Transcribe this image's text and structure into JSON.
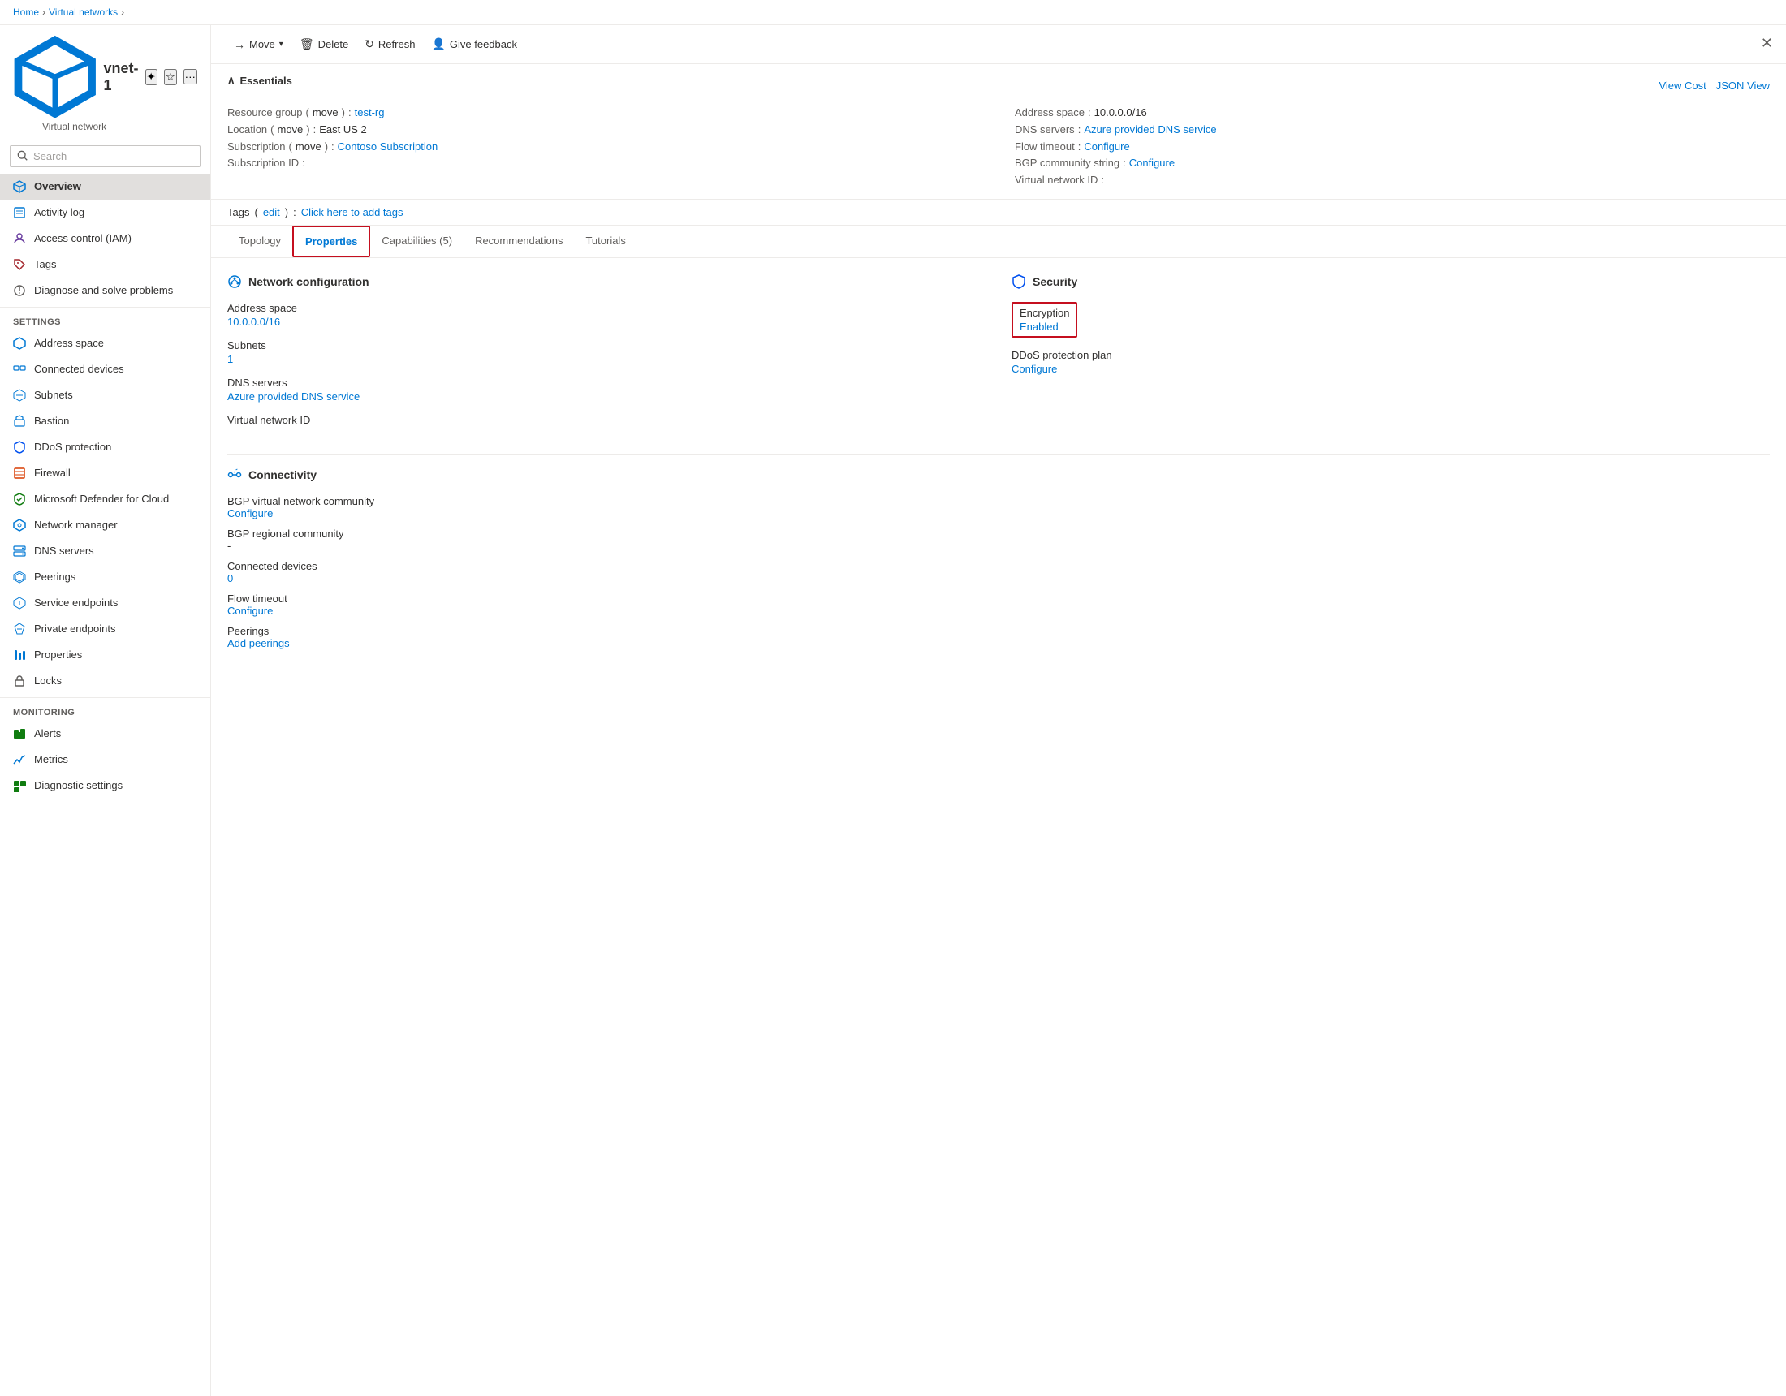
{
  "breadcrumb": {
    "home": "Home",
    "section": "Virtual networks",
    "current": ""
  },
  "header": {
    "title": "vnet-1",
    "subtitle": "Virtual network",
    "pin_label": "Pin",
    "star_label": "Favorite",
    "more_label": "More"
  },
  "sidebar": {
    "search_placeholder": "Search",
    "nav_items": [
      {
        "id": "overview",
        "label": "Overview",
        "active": true,
        "icon": "vnet"
      },
      {
        "id": "activity-log",
        "label": "Activity log",
        "active": false,
        "icon": "activity"
      },
      {
        "id": "access-control",
        "label": "Access control (IAM)",
        "active": false,
        "icon": "iam"
      },
      {
        "id": "tags",
        "label": "Tags",
        "active": false,
        "icon": "tag"
      },
      {
        "id": "diagnose",
        "label": "Diagnose and solve problems",
        "active": false,
        "icon": "wrench"
      }
    ],
    "settings_label": "Settings",
    "settings_items": [
      {
        "id": "address-space",
        "label": "Address space",
        "icon": "vnet"
      },
      {
        "id": "connected-devices",
        "label": "Connected devices",
        "icon": "devices"
      },
      {
        "id": "subnets",
        "label": "Subnets",
        "icon": "subnets"
      },
      {
        "id": "bastion",
        "label": "Bastion",
        "icon": "bastion"
      },
      {
        "id": "ddos",
        "label": "DDoS protection",
        "icon": "ddos"
      },
      {
        "id": "firewall",
        "label": "Firewall",
        "icon": "firewall"
      },
      {
        "id": "defender",
        "label": "Microsoft Defender for Cloud",
        "icon": "defender"
      },
      {
        "id": "network-manager",
        "label": "Network manager",
        "icon": "network"
      },
      {
        "id": "dns-servers",
        "label": "DNS servers",
        "icon": "dns"
      },
      {
        "id": "peerings",
        "label": "Peerings",
        "icon": "peering"
      },
      {
        "id": "service-endpoints",
        "label": "Service endpoints",
        "icon": "endpoint"
      },
      {
        "id": "private-endpoints",
        "label": "Private endpoints",
        "icon": "private"
      },
      {
        "id": "properties",
        "label": "Properties",
        "icon": "properties"
      },
      {
        "id": "locks",
        "label": "Locks",
        "icon": "lock"
      }
    ],
    "monitoring_label": "Monitoring",
    "monitoring_items": [
      {
        "id": "alerts",
        "label": "Alerts",
        "icon": "alerts"
      },
      {
        "id": "metrics",
        "label": "Metrics",
        "icon": "metrics"
      },
      {
        "id": "diagnostic",
        "label": "Diagnostic settings",
        "icon": "diagnostic"
      }
    ]
  },
  "toolbar": {
    "move_label": "Move",
    "delete_label": "Delete",
    "refresh_label": "Refresh",
    "feedback_label": "Give feedback"
  },
  "essentials": {
    "collapse_label": "Essentials",
    "view_cost_label": "View Cost",
    "json_view_label": "JSON View",
    "resource_group_label": "Resource group",
    "resource_group_move": "move",
    "resource_group_value": "test-rg",
    "location_label": "Location",
    "location_move": "move",
    "location_value": "East US 2",
    "subscription_label": "Subscription",
    "subscription_move": "move",
    "subscription_value": "Contoso Subscription",
    "subscription_id_label": "Subscription ID",
    "subscription_id_value": "",
    "address_space_label": "Address space",
    "address_space_value": "10.0.0.0/16",
    "dns_servers_label": "DNS servers",
    "dns_servers_value": "Azure provided DNS service",
    "flow_timeout_label": "Flow timeout",
    "flow_timeout_value": "Configure",
    "bgp_community_label": "BGP community string",
    "bgp_community_value": "Configure",
    "vnet_id_label": "Virtual network ID",
    "vnet_id_value": ""
  },
  "tags": {
    "label": "Tags",
    "edit_label": "edit",
    "add_label": "Click here to add tags"
  },
  "tabs": [
    {
      "id": "topology",
      "label": "Topology",
      "active": false,
      "highlighted": false
    },
    {
      "id": "properties",
      "label": "Properties",
      "active": true,
      "highlighted": true
    },
    {
      "id": "capabilities",
      "label": "Capabilities (5)",
      "active": false,
      "highlighted": false
    },
    {
      "id": "recommendations",
      "label": "Recommendations",
      "active": false,
      "highlighted": false
    },
    {
      "id": "tutorials",
      "label": "Tutorials",
      "active": false,
      "highlighted": false
    }
  ],
  "properties": {
    "network_config_title": "Network configuration",
    "address_space_label": "Address space",
    "address_space_value": "10.0.0.0/16",
    "subnets_label": "Subnets",
    "subnets_value": "1",
    "dns_servers_label": "DNS servers",
    "dns_servers_value": "Azure provided DNS service",
    "vnet_id_label": "Virtual network ID",
    "security_title": "Security",
    "encryption_label": "Encryption",
    "encryption_value": "Enabled",
    "ddos_plan_label": "DDoS protection plan",
    "ddos_configure": "Configure"
  },
  "connectivity": {
    "title": "Connectivity",
    "bgp_community_label": "BGP virtual network community",
    "bgp_community_value": "Configure",
    "bgp_regional_label": "BGP regional community",
    "bgp_regional_value": "-",
    "connected_devices_label": "Connected devices",
    "connected_devices_value": "0",
    "flow_timeout_label": "Flow timeout",
    "flow_timeout_value": "Configure",
    "peerings_label": "Peerings",
    "peerings_value": "Add peerings"
  }
}
